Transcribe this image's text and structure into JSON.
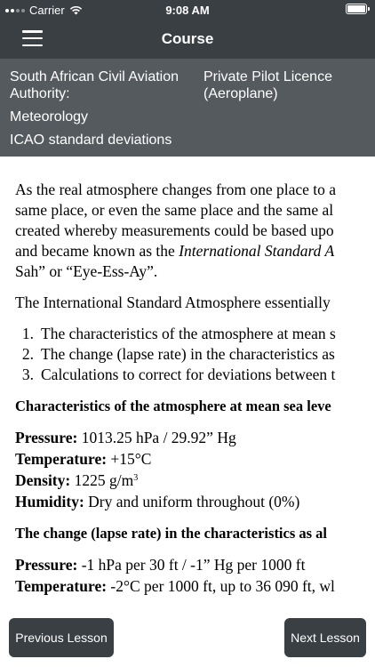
{
  "status_bar": {
    "carrier": "Carrier",
    "time": "9:08 AM"
  },
  "nav": {
    "title": "Course"
  },
  "info": {
    "authority": "South African Civil Aviation Authority:",
    "licence": "Private Pilot Licence (Aeroplane)",
    "subject": "Meteorology",
    "topic": "ICAO standard deviations"
  },
  "lesson": {
    "intro_lines": [
      "As the real atmosphere changes from one place to a",
      "same place, or even the same place and the same al",
      "created whereby measurements could be based upo"
    ],
    "intro_line4_a": "and became known as the ",
    "intro_line4_italic": "International Standard A",
    "intro_line5": "Sah” or “Eye-Ess-Ay”.",
    "isa_intro": "The International Standard Atmosphere essentially",
    "list": [
      {
        "num": "1.",
        "text": "The characteristics of the atmosphere at mean s"
      },
      {
        "num": "2.",
        "text": "The change (lapse rate) in the characteristics as"
      },
      {
        "num": "3.",
        "text": "Calculations to correct for deviations between t"
      }
    ],
    "heading_msl": "Characteristics of the atmosphere at mean sea leve",
    "pressure_label": "Pressure:",
    "pressure_value": " 1013.25 hPa / 29.92” Hg",
    "temperature_label": "Temperature:",
    "temperature_value": " +15°C",
    "density_label": "Density:",
    "density_value": " 1225 g/m",
    "density_exp": "3",
    "humidity_label": "Humidity:",
    "humidity_value": " Dry and uniform throughout (0%)",
    "heading_lapse": "The change (lapse rate) in the characteristics as al",
    "lapse_pressure_label": "Pressure:",
    "lapse_pressure_value": " -1 hPa per 30 ft / -1” Hg per 1000 ft",
    "lapse_temperature_label": "Temperature:",
    "lapse_temperature_value": " -2°C per 1000 ft, up to 36 090 ft, wl"
  },
  "buttons": {
    "previous": "Previous Lesson",
    "next": "Next Lesson"
  }
}
